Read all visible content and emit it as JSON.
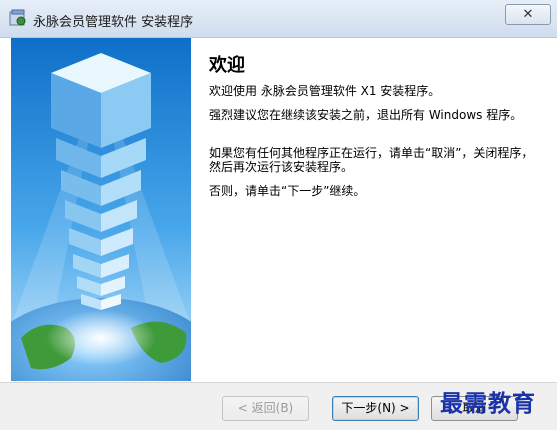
{
  "window": {
    "title": "永脉会员管理软件 安装程序",
    "close_label": "✕"
  },
  "content": {
    "heading": "欢迎",
    "paragraphs": [
      "欢迎使用 永脉会员管理软件 X1 安装程序。",
      "强烈建议您在继续该安装之前，退出所有 Windows 程序。",
      "如果您有任何其他程序正在运行，请单击“取消”，关闭程序，然后再次运行该安装程序。",
      "否则，请单击“下一步”继续。"
    ]
  },
  "buttons": {
    "back_label": "< 返回(B)",
    "next_label": "下一步(N) >",
    "cancel_label": "取消"
  },
  "watermark": "最需教育",
  "colors": {
    "accent": "#3c7fb1",
    "watermark": "#1a33a8"
  }
}
